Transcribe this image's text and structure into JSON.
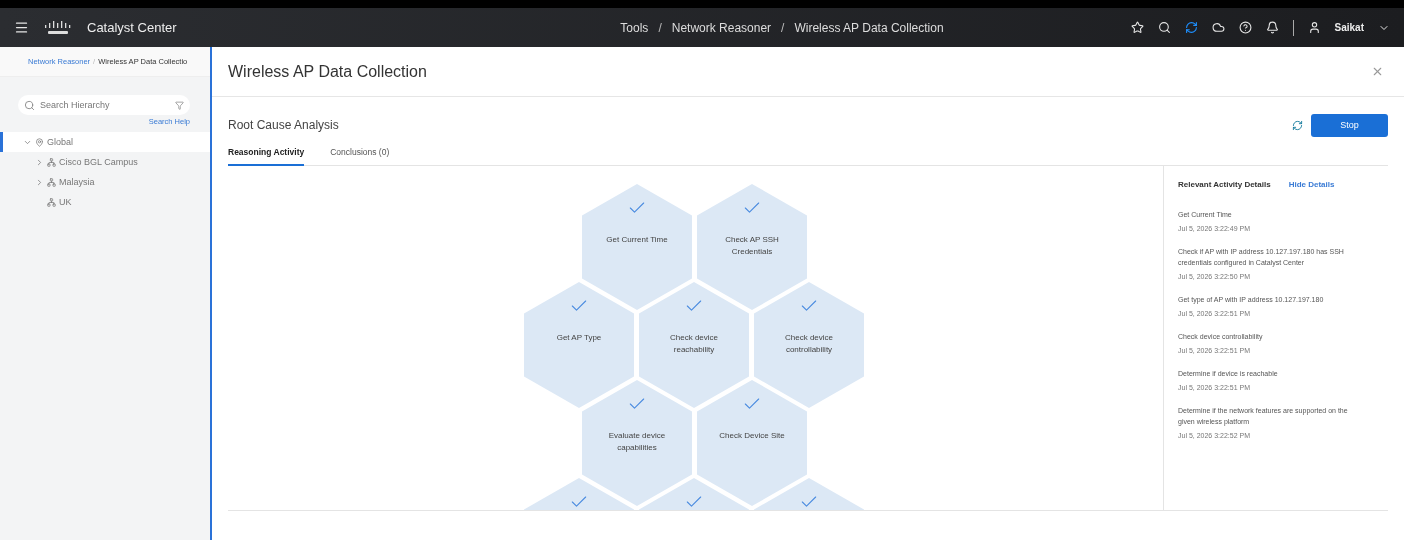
{
  "header": {
    "app_name": "Catalyst Center",
    "breadcrumb": [
      "Tools",
      "Network Reasoner",
      "Wireless AP Data Collection"
    ],
    "separator": "/",
    "user": "Saikat"
  },
  "sidebar": {
    "breadcrumb": {
      "link": "Network Reasoner",
      "separator": "/",
      "current": "Wireless AP Data Collectio"
    },
    "search": {
      "placeholder": "Search Hierarchy"
    },
    "search_help": "Search Help",
    "tree": [
      {
        "label": "Global",
        "selected": true,
        "expanded": true,
        "children": [
          {
            "label": "Cisco BGL Campus",
            "selected": false,
            "expanded": false,
            "has_children": true
          },
          {
            "label": "Malaysia",
            "selected": false,
            "expanded": false,
            "has_children": true
          },
          {
            "label": "UK",
            "selected": false,
            "expanded": false,
            "has_children": false
          }
        ]
      }
    ]
  },
  "panel": {
    "title": "Wireless AP Data Collection",
    "section_title": "Root Cause Analysis",
    "stop_button": "Stop",
    "tabs": [
      {
        "label": "Reasoning Activity",
        "selected": true
      },
      {
        "label": "Conclusions (0)",
        "selected": false
      }
    ],
    "nodes": [
      {
        "label": "Get Current Time",
        "done": true
      },
      {
        "label": "Check AP SSH Credentials",
        "done": true
      },
      {
        "label": "Get AP Type",
        "done": true
      },
      {
        "label": "Check device reachability",
        "done": true
      },
      {
        "label": "Check device controllability",
        "done": true
      },
      {
        "label": "Evaluate device capabilities",
        "done": true
      },
      {
        "label": "Check Device Site",
        "done": true
      },
      {
        "done": true
      },
      {
        "done": true
      },
      {
        "done": true
      }
    ],
    "details": {
      "title": "Relevant Activity Details",
      "hide_link": "Hide Details",
      "items": [
        {
          "text": "Get Current Time",
          "time": "Jul 5, 2026 3:22:49 PM"
        },
        {
          "text": "Check if AP with IP address 10.127.197.180 has SSH credentials configured in Catalyst Center",
          "time": "Jul 5, 2026 3:22:50 PM"
        },
        {
          "text": "Get type of AP with IP address 10.127.197.180",
          "time": "Jul 5, 2026 3:22:51 PM"
        },
        {
          "text": "Check device controllability",
          "time": "Jul 5, 2026 3:22:51 PM"
        },
        {
          "text": "Determine if device is reachable",
          "time": "Jul 5, 2026 3:22:51 PM"
        },
        {
          "text": "Determine if the network features are supported on the given wireless platform",
          "time": "Jul 5, 2026 3:22:52 PM"
        }
      ]
    }
  }
}
